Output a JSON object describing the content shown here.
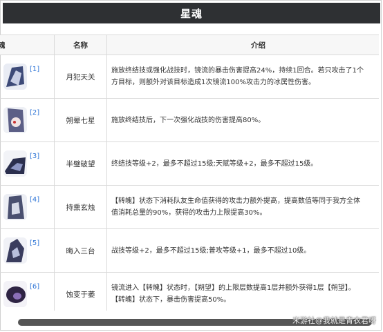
{
  "title": "星魂",
  "table": {
    "headers": [
      "魂",
      "名称",
      "介绍"
    ],
    "rows": [
      {
        "ref": "[1]",
        "name": "月犯天关",
        "desc": "施放终结技或强化战技时，镜流的暴击伤害提高24%，持续1回合。若只攻击了1个\n方目标，则额外对该目标造成1次镜流100%攻击力的冰属性伤害。"
      },
      {
        "ref": "[2]",
        "name": "朔晕七星",
        "desc": "施放终结技后，下一次强化战技的伤害提高80%。"
      },
      {
        "ref": "[3]",
        "name": "半璧破望",
        "desc": "终结技等级+2，最多不超过15级;天赋等级+2，最多不超过15级。"
      },
      {
        "ref": "[4]",
        "name": "持熏玄烛",
        "desc": "【转魄】状态下消耗队友生命值获得的攻击力额外提高，提高数值等同于我方全体\n值消耗总量的90%，获得的攻击力上限提高30%。"
      },
      {
        "ref": "[5]",
        "name": "晦入三台",
        "desc": "战技等级+2，最多不超过15级;普攻等级+1，最多不超过10级。"
      },
      {
        "ref": "[6]",
        "name": "蚀变于萎",
        "desc": "镜流进入【转魄】状态时，【朔望】的上限层数提高1层并额外获得1层【朔望】。\n【转魄】状态下，暴击伤害提高50%。"
      }
    ]
  },
  "watermark": "米游社@我就是青衣君呀"
}
